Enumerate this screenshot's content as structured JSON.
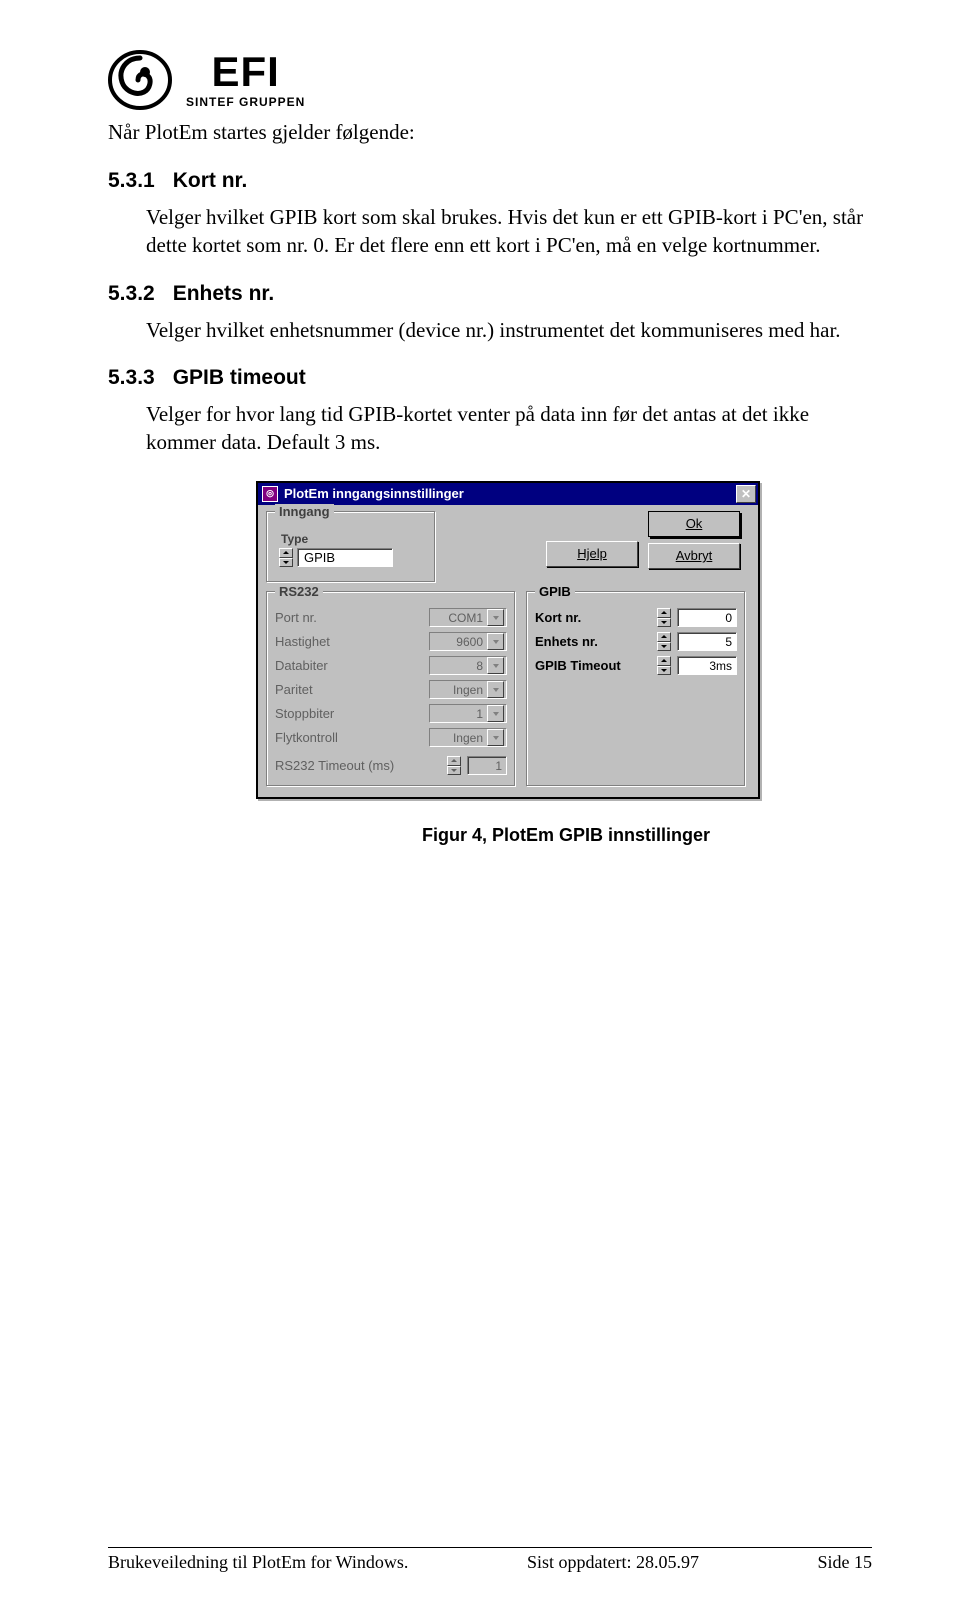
{
  "logo": {
    "big": "EFI",
    "sub": "SINTEF GRUPPEN"
  },
  "intro": "Når PlotEm startes gjelder følgende:",
  "s1": {
    "num": "5.3.1",
    "title": "Kort nr.",
    "p": "Velger hvilket GPIB kort som skal brukes. Hvis det kun er ett GPIB-kort i PC'en, står dette kortet som nr. 0. Er det flere enn ett kort i PC'en, må en velge kortnummer."
  },
  "s2": {
    "num": "5.3.2",
    "title": "Enhets nr.",
    "p": "Velger hvilket enhetsnummer (device nr.) instrumentet det kommuniseres med har."
  },
  "s3": {
    "num": "5.3.3",
    "title": "GPIB timeout",
    "p1": "Velger for hvor lang tid GPIB-kortet venter på data inn før det antas at det ikke kommer data. Default 3 ms."
  },
  "dialog": {
    "title": "PlotEm inngangsinnstillinger",
    "groups": {
      "inngang": "Inngang",
      "typelbl": "Type",
      "rs232": "RS232",
      "gpib": "GPIB"
    },
    "type_value": "GPIB",
    "buttons": {
      "ok": "Ok",
      "hjelp": "Hjelp",
      "avbryt": "Avbryt"
    },
    "rs232": {
      "port": {
        "label": "Port nr.",
        "value": "COM1"
      },
      "hastighet": {
        "label": "Hastighet",
        "value": "9600"
      },
      "databiter": {
        "label": "Databiter",
        "value": "8"
      },
      "paritet": {
        "label": "Paritet",
        "value": "Ingen"
      },
      "stoppbiter": {
        "label": "Stoppbiter",
        "value": "1"
      },
      "flyt": {
        "label": "Flytkontroll",
        "value": "Ingen"
      },
      "timeout": {
        "label": "RS232 Timeout (ms)",
        "value": "1"
      }
    },
    "gpib": {
      "kort": {
        "label": "Kort nr.",
        "value": "0"
      },
      "enhets": {
        "label": "Enhets nr.",
        "value": "5"
      },
      "timeout": {
        "label": "GPIB Timeout",
        "value": "3ms"
      }
    }
  },
  "figcaption": "Figur 4, PlotEm GPIB innstillinger",
  "footer": {
    "left": "Brukeveiledning til PlotEm for Windows.",
    "mid": "Sist oppdatert: 28.05.97",
    "right": "Side 15"
  }
}
